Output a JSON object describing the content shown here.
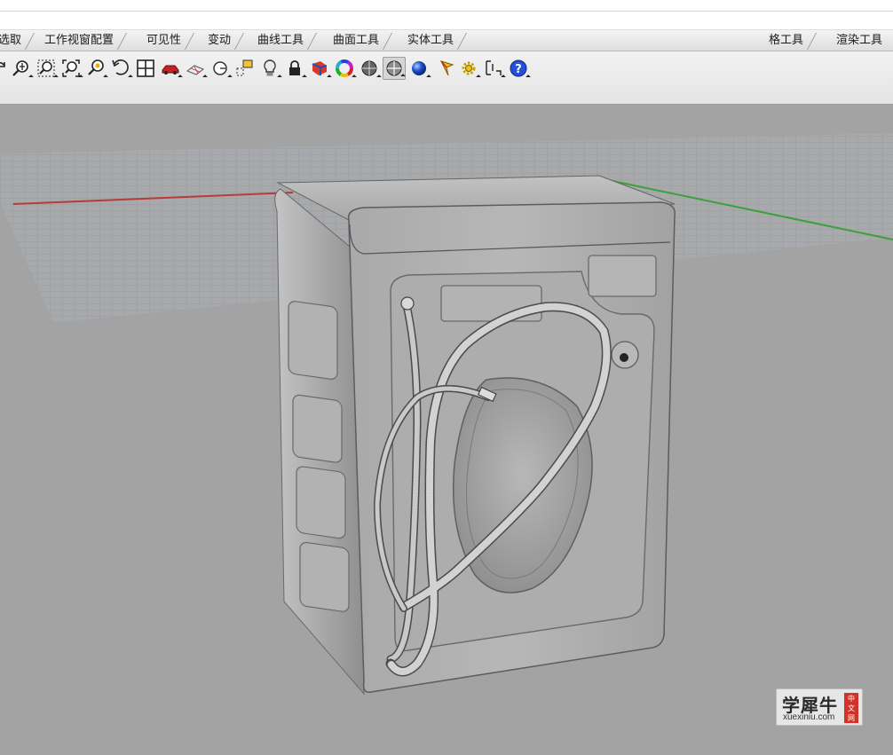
{
  "tabs": {
    "left": [
      "选取",
      "工作视窗配置",
      "可见性",
      "变动",
      "曲线工具",
      "曲面工具",
      "实体工具"
    ],
    "right": [
      "格工具",
      "渲染工具"
    ]
  },
  "toolbar": {
    "icons": [
      "rotate-view-icon",
      "zoom-dynamic-icon",
      "zoom-window-icon",
      "zoom-extents-icon",
      "zoom-selected-icon",
      "undo-view-change-icon",
      "four-viewports-icon",
      "set-camera-icon",
      "cplane-icon",
      "circle-point-icon",
      "named-view-icon",
      "light-bulb-icon",
      "lock-icon",
      "render-color-icon",
      "color-wheel-icon",
      "shaded-sphere-icon",
      "rendered-sphere-icon",
      "blue-sphere-icon",
      "analysis-flag-icon",
      "settings-gear-icon",
      "dimension-icon",
      "help-icon"
    ]
  },
  "viewport": {
    "x_axis_color": "#b83a3a",
    "y_axis_color": "#3aa03a",
    "grid_color": "#9096a0",
    "background": "#a3a3a3"
  },
  "watermark": {
    "brand": "学犀牛",
    "site": "xuexiniu.com",
    "badge": "中文网"
  }
}
